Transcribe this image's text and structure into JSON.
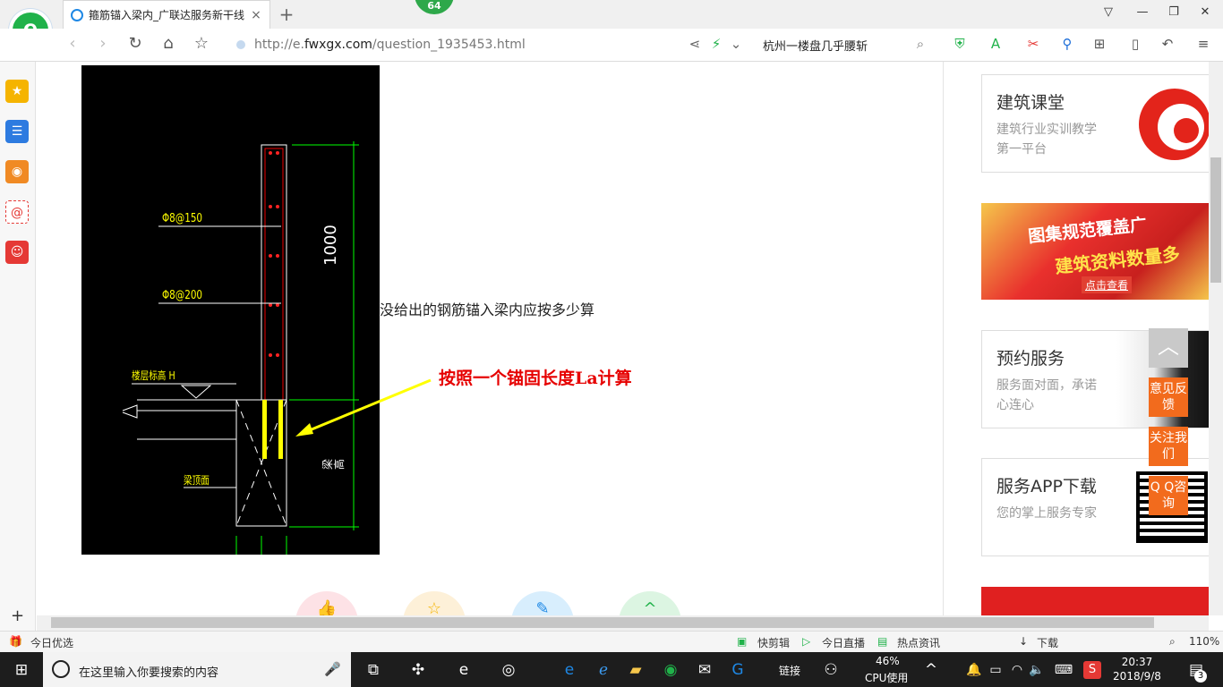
{
  "browser": {
    "tab_title": "箍筋锚入梁内_广联达服务新干线",
    "tab_close": "×",
    "new_tab": "+",
    "badge": "64",
    "logo_letter": "e",
    "url": {
      "scheme": "http://e.",
      "domain": "fwxgx.com",
      "path": "/question_1935453.html"
    },
    "search_query": "杭州一楼盘几乎腰斩"
  },
  "drawing": {
    "label_rebar_150": "Φ8@150",
    "label_rebar_200": "Φ8@200",
    "label_floor_height": "楼层标高 H",
    "label_beam_face": "梁顶面",
    "label_dim": "1000",
    "label_beam_height": "梁高"
  },
  "question": {
    "text": "没给出的钢筋锚入梁内应按多少算",
    "answer": "按照一个锚固长度La计算"
  },
  "sidebar_cards": [
    {
      "title": "建筑课堂",
      "subtitle": "建筑行业实训教学第一平台"
    },
    {
      "title": "预约服务",
      "subtitle": "服务面对面，承诺心连心"
    },
    {
      "title": "服务APP下载",
      "subtitle": "您的掌上服务专家"
    }
  ],
  "promo": {
    "line1": "图集规范覆盖广",
    "line2": "建筑资料数量多",
    "cta": "点击查看"
  },
  "float_buttons": {
    "top": "︿",
    "feedback": "意见反馈",
    "follow": "关注我们",
    "qq": "Q Q咨询"
  },
  "statusbar": {
    "left": "今日优选",
    "quick_clip": "快剪辑",
    "live": "今日直播",
    "news": "热点资讯",
    "download": "下载",
    "zoom": "110%"
  },
  "taskbar": {
    "search_placeholder": "在这里输入你要搜索的内容",
    "link_label": "链接",
    "cpu_pct": "46%",
    "cpu_label": "CPU使用",
    "time": "20:37",
    "date": "2018/9/8",
    "notif_count": "3"
  },
  "colors": {
    "accent_green": "#20b24a",
    "answer_red": "#e60000",
    "float_orange": "#f26b1d",
    "cad_bg": "#000000"
  }
}
